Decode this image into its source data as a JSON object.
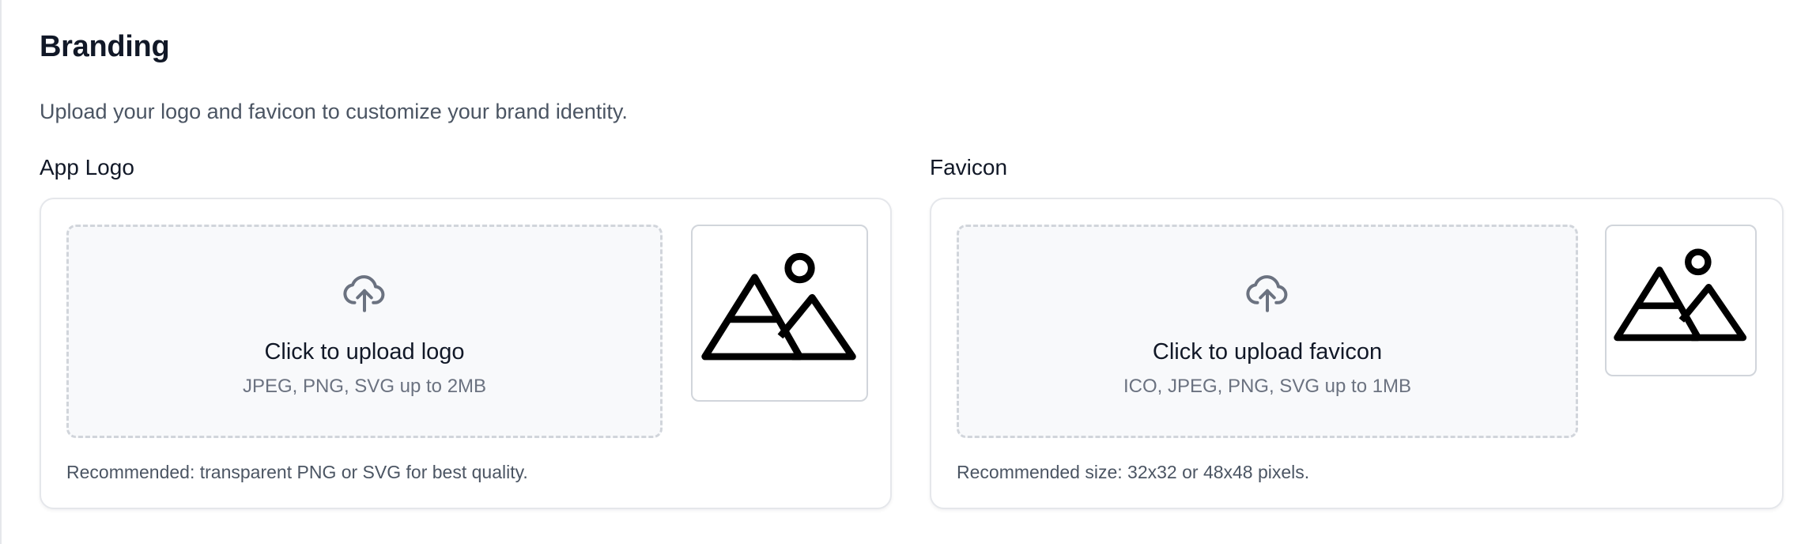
{
  "section": {
    "title": "Branding",
    "subtitle": "Upload your logo and favicon to customize your brand identity."
  },
  "logo": {
    "label": "App Logo",
    "upload_title": "Click to upload logo",
    "upload_hint": "JPEG, PNG, SVG up to 2MB",
    "note": "Recommended: transparent PNG or SVG for best quality.",
    "upload_icon": "cloud-upload-icon",
    "preview_icon": "image-placeholder-icon"
  },
  "favicon": {
    "label": "Favicon",
    "upload_title": "Click to upload favicon",
    "upload_hint": "ICO, JPEG, PNG, SVG up to 1MB",
    "note": "Recommended size: 32x32 or 48x48 pixels.",
    "upload_icon": "cloud-upload-icon",
    "preview_icon": "image-placeholder-icon"
  },
  "colors": {
    "text_primary": "#111827",
    "text_secondary": "#4b5563",
    "text_muted": "#6b7280",
    "border": "#e5e7eb",
    "dropzone_bg": "#f8f9fb",
    "icon_gray": "#6b7280"
  }
}
